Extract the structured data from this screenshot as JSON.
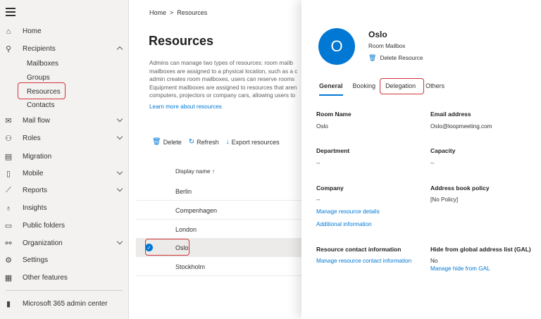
{
  "sidebar": {
    "items": [
      {
        "label": "Home",
        "icon": "home-icon"
      },
      {
        "label": "Recipients",
        "icon": "person-icon"
      },
      {
        "label": "Mail flow",
        "icon": "mail-icon"
      },
      {
        "label": "Roles",
        "icon": "roles-icon"
      },
      {
        "label": "Migration",
        "icon": "migration-icon"
      },
      {
        "label": "Mobile",
        "icon": "mobile-icon"
      },
      {
        "label": "Reports",
        "icon": "reports-icon"
      },
      {
        "label": "Insights",
        "icon": "insights-icon"
      },
      {
        "label": "Public folders",
        "icon": "folder-icon"
      },
      {
        "label": "Organization",
        "icon": "organization-icon"
      },
      {
        "label": "Settings",
        "icon": "gear-icon"
      },
      {
        "label": "Other features",
        "icon": "grid-icon"
      },
      {
        "label": "Microsoft 365 admin center",
        "icon": "office-icon"
      }
    ],
    "recipients_sub": [
      "Mailboxes",
      "Groups",
      "Resources",
      "Contacts"
    ]
  },
  "breadcrumb": {
    "home": "Home",
    "sep": ">",
    "current": "Resources"
  },
  "page": {
    "title": "Resources",
    "description": "Admins can manage two types of resources: room mailb\nmailboxes are assigned to a physical location, such as a c\nadmin creates room mailboxes, users can reserve rooms\nEquipment mailboxes are assigned to resources that aren\ncomputers, projectors or company cars, allowing users to",
    "learn_more": "Learn more about resources"
  },
  "toolbar": {
    "delete": "Delete",
    "refresh": "Refresh",
    "export": "Export resources"
  },
  "table": {
    "header": "Display name ↑",
    "rows": [
      "Berlin",
      "Compenhagen",
      "London",
      "Oslo",
      "Stockholm"
    ]
  },
  "panel": {
    "initial": "O",
    "name": "Oslo",
    "type": "Room Mailbox",
    "delete": "Delete Resource",
    "tabs": [
      "General",
      "Booking",
      "Delegation",
      "Others"
    ],
    "room_name_label": "Room Name",
    "room_name_value": "Oslo",
    "email_label": "Email address",
    "email_value": "Oslo@loopmeeting.com",
    "department_label": "Department",
    "department_value": "--",
    "capacity_label": "Capacity",
    "capacity_value": "--",
    "company_label": "Company",
    "company_value": "--",
    "abp_label": "Address book policy",
    "abp_value": "[No Policy]",
    "manage_details": "Manage resource details",
    "additional_info": "Additional information",
    "contact_label": "Resource contact information",
    "contact_link": "Manage resource contact information",
    "gal_label": "Hide from global address list (GAL)",
    "gal_value": "No",
    "gal_link": "Manage hide from GAL"
  },
  "colors": {
    "accent": "#0078d4",
    "highlight": "#d13438"
  }
}
